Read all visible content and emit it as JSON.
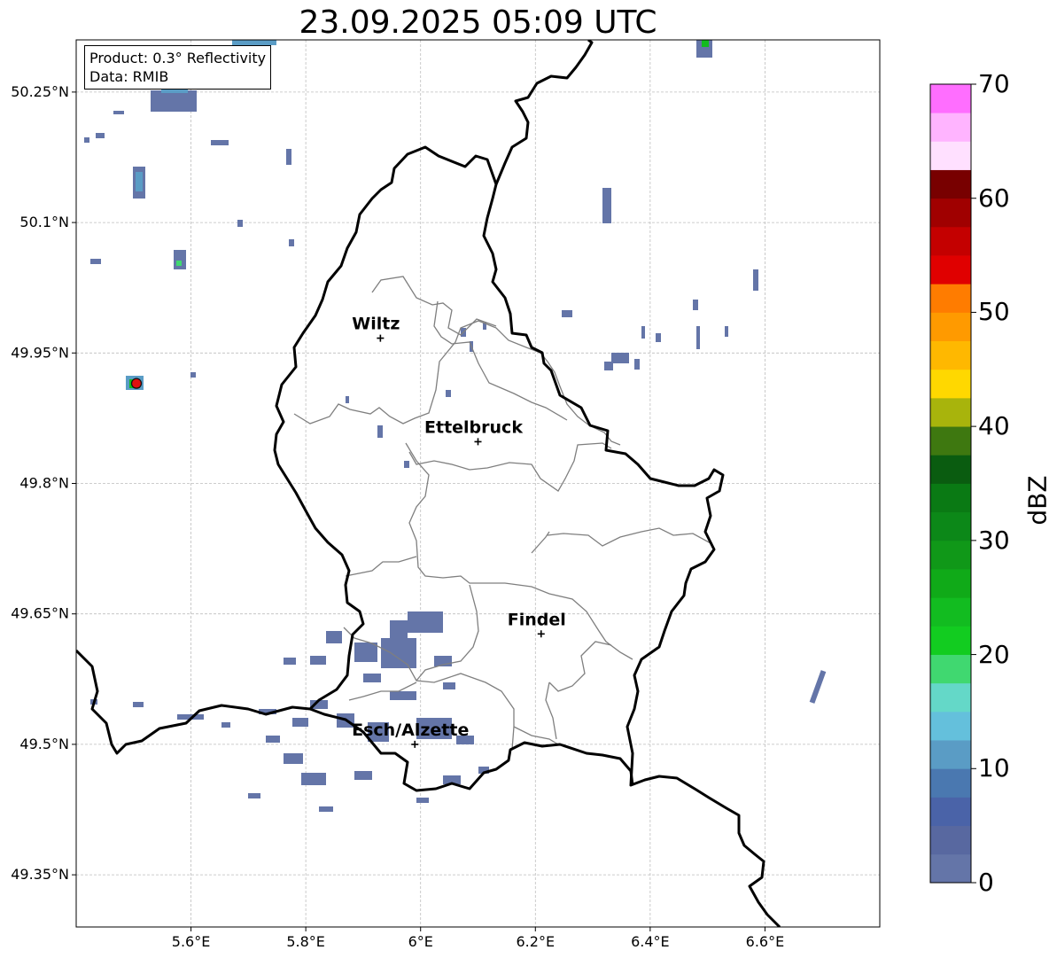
{
  "title": "23.09.2025 05:09 UTC",
  "info_box": {
    "product_line": "Product: 0.3° Reflectivity",
    "data_line": "Data: RMIB"
  },
  "map_extent": {
    "lon_min": 5.4,
    "lon_max": 6.8,
    "lat_min": 49.29,
    "lat_max": 50.31
  },
  "lat_ticks": [
    {
      "value": 50.25,
      "label": "50.25°N"
    },
    {
      "value": 50.1,
      "label": "50.1°N"
    },
    {
      "value": 49.95,
      "label": "49.95°N"
    },
    {
      "value": 49.8,
      "label": "49.8°N"
    },
    {
      "value": 49.65,
      "label": "49.65°N"
    },
    {
      "value": 49.5,
      "label": "49.5°N"
    },
    {
      "value": 49.35,
      "label": "49.35°N"
    }
  ],
  "lon_ticks": [
    {
      "value": 5.6,
      "label": "5.6°E"
    },
    {
      "value": 5.8,
      "label": "5.8°E"
    },
    {
      "value": 6.0,
      "label": "6°E"
    },
    {
      "value": 6.2,
      "label": "6.2°E"
    },
    {
      "value": 6.4,
      "label": "6.4°E"
    },
    {
      "value": 6.6,
      "label": "6.6°E"
    }
  ],
  "cities": [
    {
      "name": "Wiltz",
      "lon": 5.93,
      "lat": 49.967
    },
    {
      "name": "Ettelbruck",
      "lon": 6.1,
      "lat": 49.848
    },
    {
      "name": "Findel",
      "lon": 6.21,
      "lat": 49.627
    },
    {
      "name": "Esch/Alzette",
      "lon": 5.99,
      "lat": 49.5
    }
  ],
  "radar_site": {
    "lon": 5.505,
    "lat": 49.915,
    "color": "#e01010"
  },
  "colorbar": {
    "label": "dBZ",
    "min": 0,
    "max": 70,
    "step": 2.5,
    "ticks": [
      {
        "value": 0,
        "label": "0"
      },
      {
        "value": 10,
        "label": "10"
      },
      {
        "value": 20,
        "label": "20"
      },
      {
        "value": 30,
        "label": "30"
      },
      {
        "value": 40,
        "label": "40"
      },
      {
        "value": 50,
        "label": "50"
      },
      {
        "value": 60,
        "label": "60"
      },
      {
        "value": 70,
        "label": "70"
      }
    ],
    "colors": [
      "#6475a8",
      "#5868a0",
      "#4a63a8",
      "#4a78b0",
      "#5a9cc5",
      "#64c0dc",
      "#64d8c8",
      "#40d870",
      "#12cc20",
      "#12bc20",
      "#10aa18",
      "#109818",
      "#0c8818",
      "#0a7a14",
      "#0a5c10",
      "#3e7810",
      "#a8b40c",
      "#ffd800",
      "#ffb800",
      "#ff9a00",
      "#ff7c00",
      "#e00000",
      "#c40000",
      "#a00000",
      "#780000",
      "#ffe0ff",
      "#ffb4ff",
      "#ff6eff",
      "#e634e8"
    ]
  }
}
